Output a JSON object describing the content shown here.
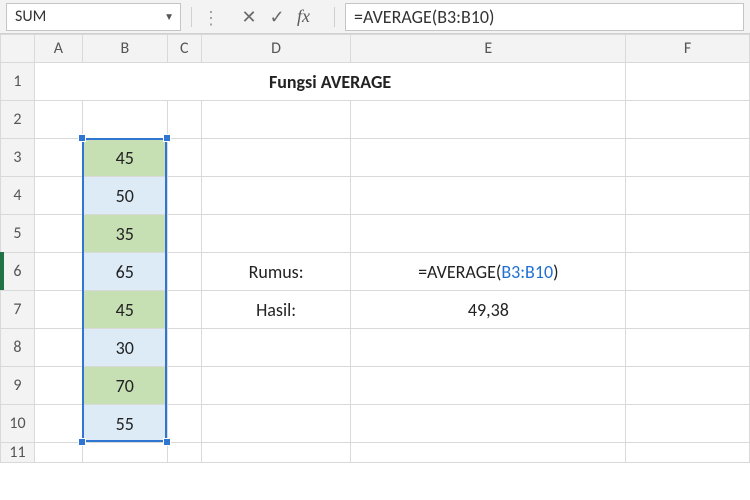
{
  "formula_bar": {
    "name_box": "SUM",
    "cancel_glyph": "✕",
    "accept_glyph": "✓",
    "fx_label": "fx",
    "formula": "=AVERAGE(B3:B10)"
  },
  "columns": [
    "A",
    "B",
    "C",
    "D",
    "E",
    "F"
  ],
  "rows": [
    "1",
    "2",
    "3",
    "4",
    "5",
    "6",
    "7",
    "8",
    "9",
    "10",
    "11"
  ],
  "title": "Fungsi AVERAGE",
  "b_values": {
    "b3": "45",
    "b4": "50",
    "b5": "35",
    "b6": "65",
    "b7": "45",
    "b8": "30",
    "b9": "70",
    "b10": "55"
  },
  "labels": {
    "rumus": "Rumus:",
    "hasil": "Hasil:"
  },
  "formula_parts": {
    "p1": "=AVERAGE(",
    "p2": "B3:B10",
    "p3": ")"
  },
  "result": "49,38",
  "active": {
    "col": "E",
    "row": "6"
  },
  "chart_data": {
    "type": "table",
    "title": "Fungsi AVERAGE",
    "series": [
      {
        "name": "B",
        "values": [
          45,
          50,
          35,
          65,
          45,
          30,
          70,
          55
        ],
        "row_start": 3,
        "row_end": 10
      }
    ],
    "formula": "=AVERAGE(B3:B10)",
    "result_numeric": 49.38
  }
}
